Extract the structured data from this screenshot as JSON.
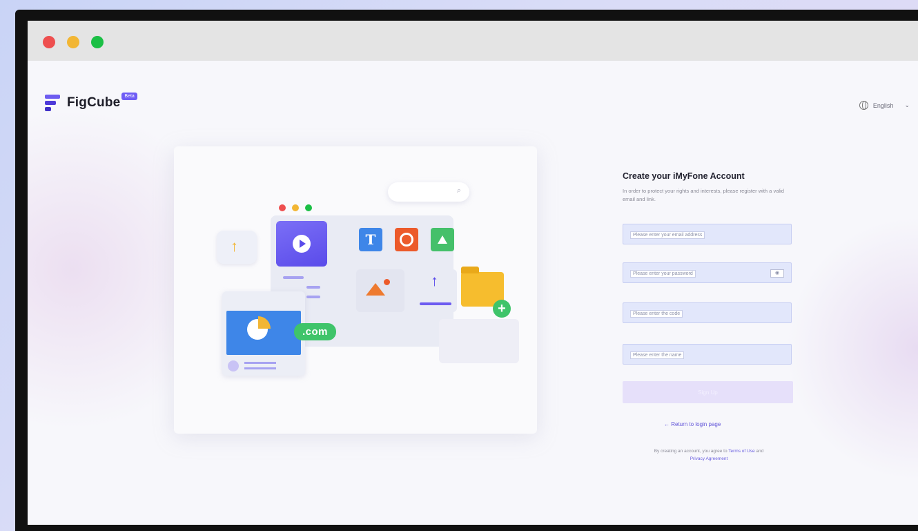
{
  "window": {
    "traffic_lights": [
      "close",
      "minimize",
      "zoom"
    ]
  },
  "brand": {
    "name": "FigCube",
    "badge": "Beta"
  },
  "language": {
    "label": "English"
  },
  "illustration": {
    "letter_tile": "T",
    "domain_badge": ".com"
  },
  "form": {
    "title": "Create your iMyFone Account",
    "subtitle": "In order to protect your rights and interests, please register with a valid email and link.",
    "fields": [
      {
        "placeholder": "Please enter your email address"
      },
      {
        "placeholder": "Please enter your password"
      },
      {
        "placeholder": "Please enter the code"
      },
      {
        "placeholder": "Please enter the name"
      }
    ],
    "submit_label": "Sign Up",
    "back_link": "← Return to login page",
    "terms_prefix": "By creating an account, you agree to",
    "terms_link1": "Terms of Use",
    "terms_and": "and",
    "terms_link2": "Privacy Agreement"
  },
  "colors": {
    "accent": "#6e5cf5",
    "field_bg": "#e2e7fb",
    "button_bg": "#e6e0fa"
  }
}
